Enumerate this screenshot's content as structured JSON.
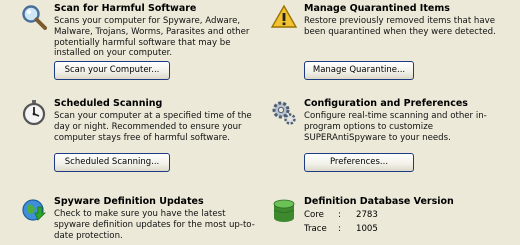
{
  "scan": {
    "title": "Scan for Harmful Software",
    "description": "Scans your computer for Spyware, Adware, Malware, Trojans, Worms, Parasites and other potentially harmful software that may be installed on your computer.",
    "button": "Scan your Computer..."
  },
  "quarantine": {
    "title": "Manage Quarantined Items",
    "description": "Restore previously removed items that have been quarantined when they were detected.",
    "button": "Manage Quarantine..."
  },
  "scheduled": {
    "title": "Scheduled Scanning",
    "description": "Scan your computer at a specified time of the day or night. Recommended to ensure your computer stays free of harmful software.",
    "button": "Scheduled Scanning..."
  },
  "config": {
    "title": "Configuration and Preferences",
    "description": "Configure real-time scanning and other in-program options to customize SUPERAntiSpyware to your needs.",
    "button": "Preferences..."
  },
  "updates": {
    "title": "Spyware Definition Updates",
    "description": "Check to make sure you have the latest spyware definition updates for the most up-to-date protection."
  },
  "database": {
    "title": "Definition Database Version",
    "core_label": "Core",
    "core_sep": ":",
    "core_value": "2783",
    "trace_label": "Trace",
    "trace_sep": ":",
    "trace_value": "1005"
  }
}
